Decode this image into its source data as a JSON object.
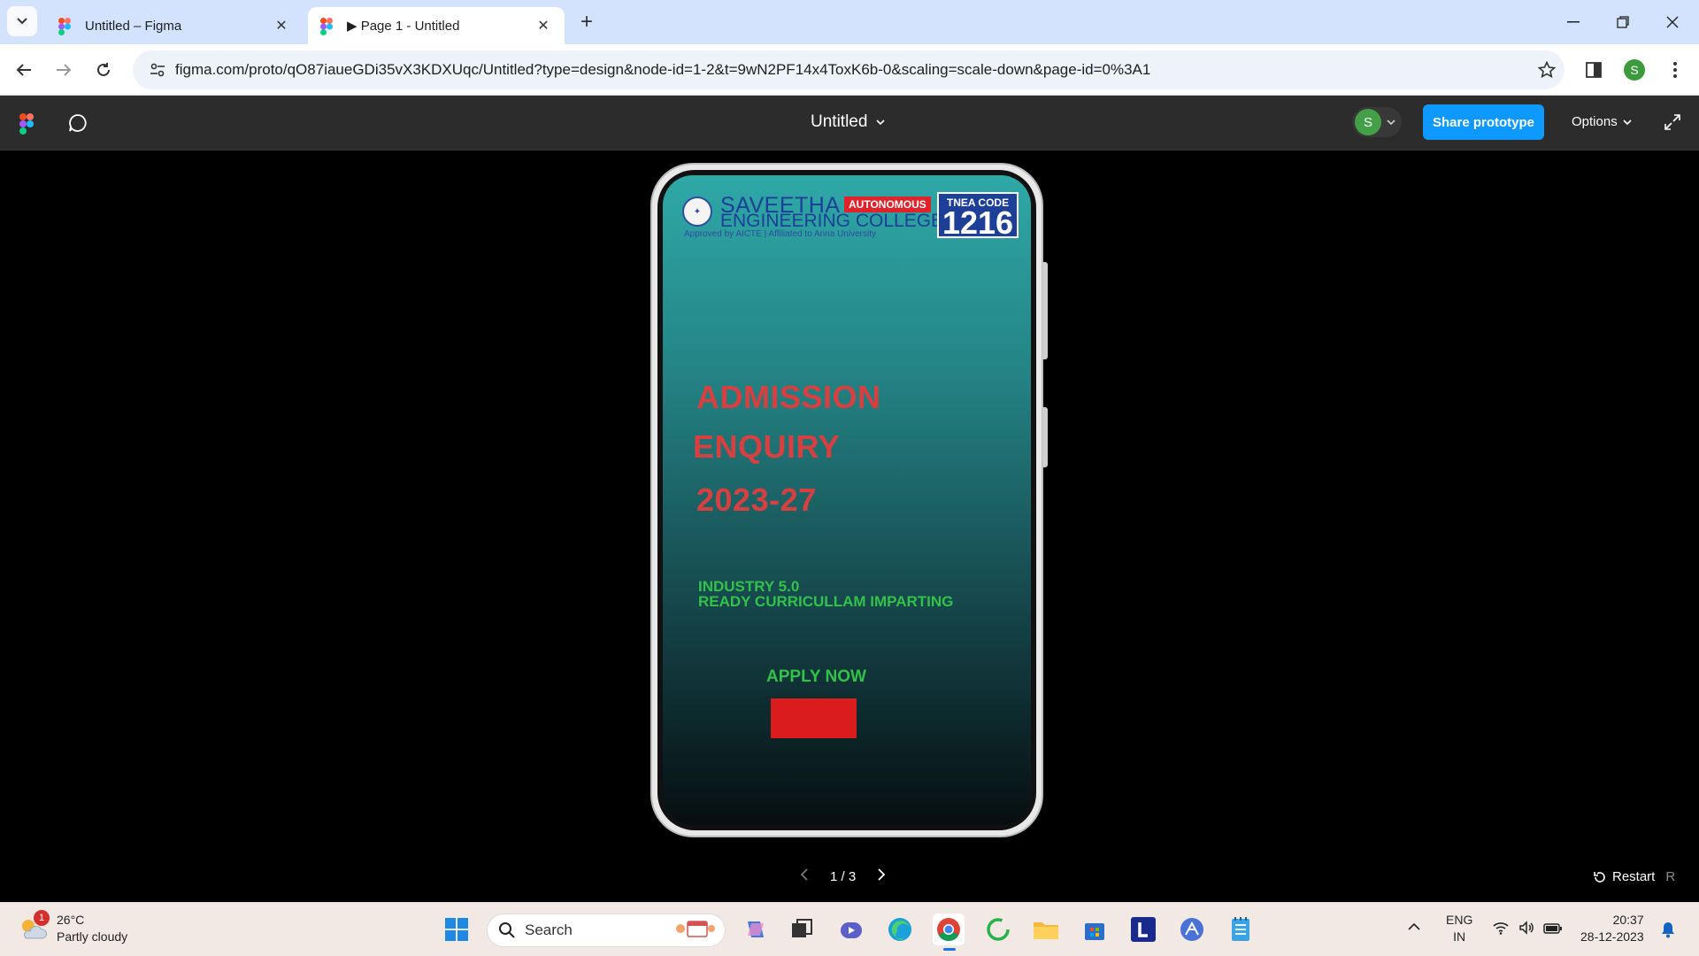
{
  "browser": {
    "tabs": [
      {
        "title": "Untitled – Figma",
        "active": false
      },
      {
        "title": "▶ Page 1 - Untitled",
        "active": true
      }
    ],
    "url": "figma.com/proto/qO87iaueGDi35vX3KDXUqc/Untitled?type=design&node-id=1-2&t=9wN2PF14x4ToxK6b-0&scaling=scale-down&page-id=0%3A1",
    "profile_initial": "S"
  },
  "figma": {
    "file_title": "Untitled",
    "avatar_initial": "S",
    "share_label": "Share prototype",
    "options_label": "Options"
  },
  "screen": {
    "college_line1": "SAVEETHA",
    "autonomous": "AUTONOMOUS",
    "college_line2": "ENGINEERING COLLEGE",
    "approved": "Approved by AICTE | Affiliated to Anna University",
    "tnea_label": "TNEA CODE",
    "tnea_code": "1216",
    "headline1": "ADMISSION",
    "headline2": "ENQUIRY",
    "headline3": "2023-27",
    "tagline1": "INDUSTRY 5.0",
    "tagline2": "READY CURRICULLAM IMPARTING",
    "apply": "APPLY NOW"
  },
  "prototype_nav": {
    "page_indicator": "1 / 3",
    "restart_label": "Restart",
    "restart_key": "R"
  },
  "taskbar": {
    "weather_badge": "1",
    "temperature": "26°C",
    "condition": "Partly cloudy",
    "search_placeholder": "Search",
    "lang1": "ENG",
    "lang2": "IN",
    "time": "20:37",
    "date": "28-12-2023"
  },
  "colors": {
    "share_button": "#0d99ff",
    "headline": "#d64040",
    "tagline": "#33c14a",
    "apply_block": "#da1c1c"
  }
}
